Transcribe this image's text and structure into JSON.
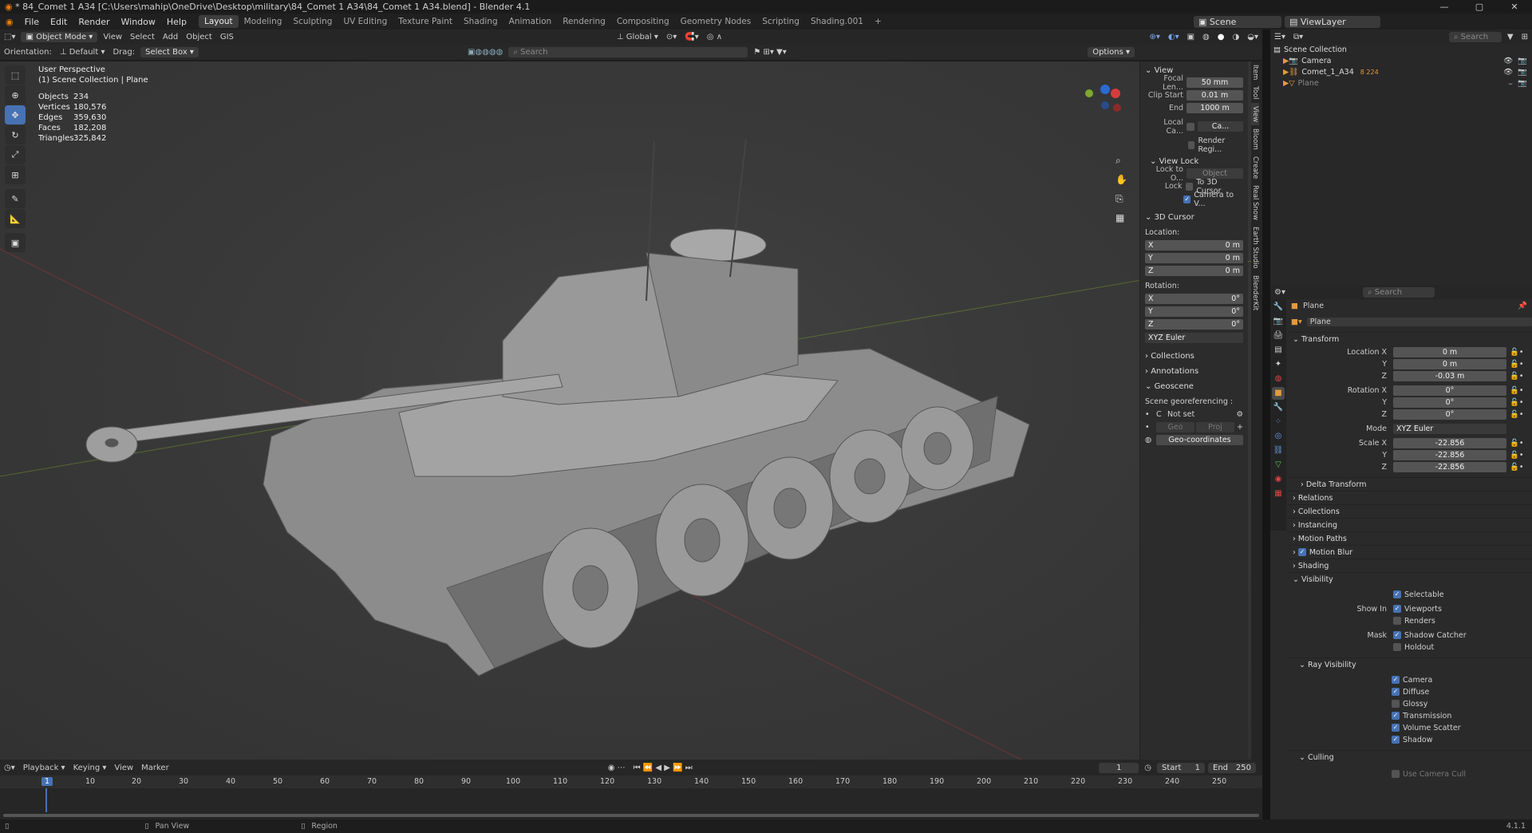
{
  "window": {
    "title": "* 84_Comet 1 A34 [C:\\Users\\mahip\\OneDrive\\Desktop\\military\\84_Comet 1 A34\\84_Comet 1 A34.blend] - Blender 4.1"
  },
  "menu": {
    "items": [
      "File",
      "Edit",
      "Render",
      "Window",
      "Help"
    ],
    "workspaces": [
      "Layout",
      "Modeling",
      "Sculpting",
      "UV Editing",
      "Texture Paint",
      "Shading",
      "Animation",
      "Rendering",
      "Compositing",
      "Geometry Nodes",
      "Scripting",
      "Shading.001"
    ],
    "active_workspace": "Layout",
    "scene": "Scene",
    "view_layer": "ViewLayer"
  },
  "header": {
    "mode": "Object Mode",
    "menus": [
      "View",
      "Select",
      "Add",
      "Object",
      "GIS"
    ],
    "transform": "Global",
    "search_placeholder": "Search",
    "options": "Options"
  },
  "toolsettings": {
    "orientation_label": "Orientation:",
    "orientation": "Default",
    "drag_label": "Drag:",
    "drag": "Select Box"
  },
  "viewport": {
    "persp": "User Perspective",
    "collection": "(1) Scene Collection | Plane",
    "stats": [
      {
        "k": "Objects",
        "v": "234"
      },
      {
        "k": "Vertices",
        "v": "180,576"
      },
      {
        "k": "Edges",
        "v": "359,630"
      },
      {
        "k": "Faces",
        "v": "182,208"
      },
      {
        "k": "Triangles",
        "v": "325,842"
      }
    ]
  },
  "npanel": {
    "view_title": "View",
    "focal_label": "Focal Len...",
    "focal": "50 mm",
    "clip_start_label": "Clip Start",
    "clip_start": "0.01 m",
    "end_label": "End",
    "end": "1000 m",
    "local_cam_label": "Local Ca...",
    "local_cam": "Ca...",
    "render_region": "Render Regi...",
    "view_lock": "View Lock",
    "lock_to_label": "Lock to O...",
    "lock_obj_ph": "Object",
    "lock_label": "Lock",
    "to_cursor": "To 3D Cursor",
    "cam_to_view": "Camera to V...",
    "cursor_title": "3D Cursor",
    "location": "Location:",
    "rotation": "Rotation:",
    "loc": [
      {
        "a": "X",
        "v": "0 m"
      },
      {
        "a": "Y",
        "v": "0 m"
      },
      {
        "a": "Z",
        "v": "0 m"
      }
    ],
    "rot": [
      {
        "a": "X",
        "v": "0°"
      },
      {
        "a": "Y",
        "v": "0°"
      },
      {
        "a": "Z",
        "v": "0°"
      }
    ],
    "rot_mode": "XYZ Euler",
    "collections": "Collections",
    "annotations": "Annotations",
    "geoscene": "Geoscene",
    "georef": "Scene georeferencing :",
    "not_set": "Not set",
    "geo": "Geo",
    "proj": "Proj",
    "geo_coords": "Geo-coordinates",
    "tabs": [
      "Item",
      "Tool",
      "View",
      "Bloom",
      "Create",
      "Real Snow",
      "Earth Studio",
      "BlenderKit"
    ]
  },
  "outliner": {
    "search_ph": "Search",
    "root": "Scene Collection",
    "items": [
      "Camera",
      "Comet_1_A34",
      "Plane"
    ],
    "comet_badge": "8 224"
  },
  "properties": {
    "search_ph": "Search",
    "object": "Plane",
    "data": "Plane",
    "transform": "Transform",
    "rows": [
      {
        "l": "Location X",
        "v": "0 m"
      },
      {
        "l": "Y",
        "v": "0 m"
      },
      {
        "l": "Z",
        "v": "-0.03 m"
      },
      {
        "l": "Rotation X",
        "v": "0°"
      },
      {
        "l": "Y",
        "v": "0°"
      },
      {
        "l": "Z",
        "v": "0°"
      }
    ],
    "mode_label": "Mode",
    "mode": "XYZ Euler",
    "scale": [
      {
        "l": "Scale X",
        "v": "-22.856"
      },
      {
        "l": "Y",
        "v": "-22.856"
      },
      {
        "l": "Z",
        "v": "-22.856"
      }
    ],
    "delta": "Delta Transform",
    "sections": [
      "Relations",
      "Collections",
      "Instancing",
      "Motion Paths",
      "Motion Blur",
      "Shading",
      "Visibility"
    ],
    "selectable": "Selectable",
    "show_in": "Show In",
    "viewports": "Viewports",
    "renders": "Renders",
    "mask": "Mask",
    "shadow_catcher": "Shadow Catcher",
    "holdout": "Holdout",
    "ray_visibility": "Ray Visibility",
    "rays": [
      "Camera",
      "Diffuse",
      "Glossy",
      "Transmission",
      "Volume Scatter",
      "Shadow"
    ],
    "rays_on": [
      true,
      true,
      false,
      true,
      true,
      true
    ],
    "culling": "Culling",
    "use_camera_cull": "Use Camera Cull"
  },
  "timeline": {
    "menus": [
      "Playback",
      "Keying",
      "View",
      "Marker"
    ],
    "current": "1",
    "start_label": "Start",
    "start": "1",
    "end_label": "End",
    "end": "250",
    "ticks": [
      "1",
      "10",
      "20",
      "30",
      "40",
      "50",
      "60",
      "70",
      "80",
      "90",
      "100",
      "110",
      "120",
      "130",
      "140",
      "150",
      "160",
      "170",
      "180",
      "190",
      "200",
      "210",
      "220",
      "230",
      "240",
      "250"
    ]
  },
  "status": {
    "pan": "Pan View",
    "region": "Region",
    "version": "4.1.1"
  }
}
